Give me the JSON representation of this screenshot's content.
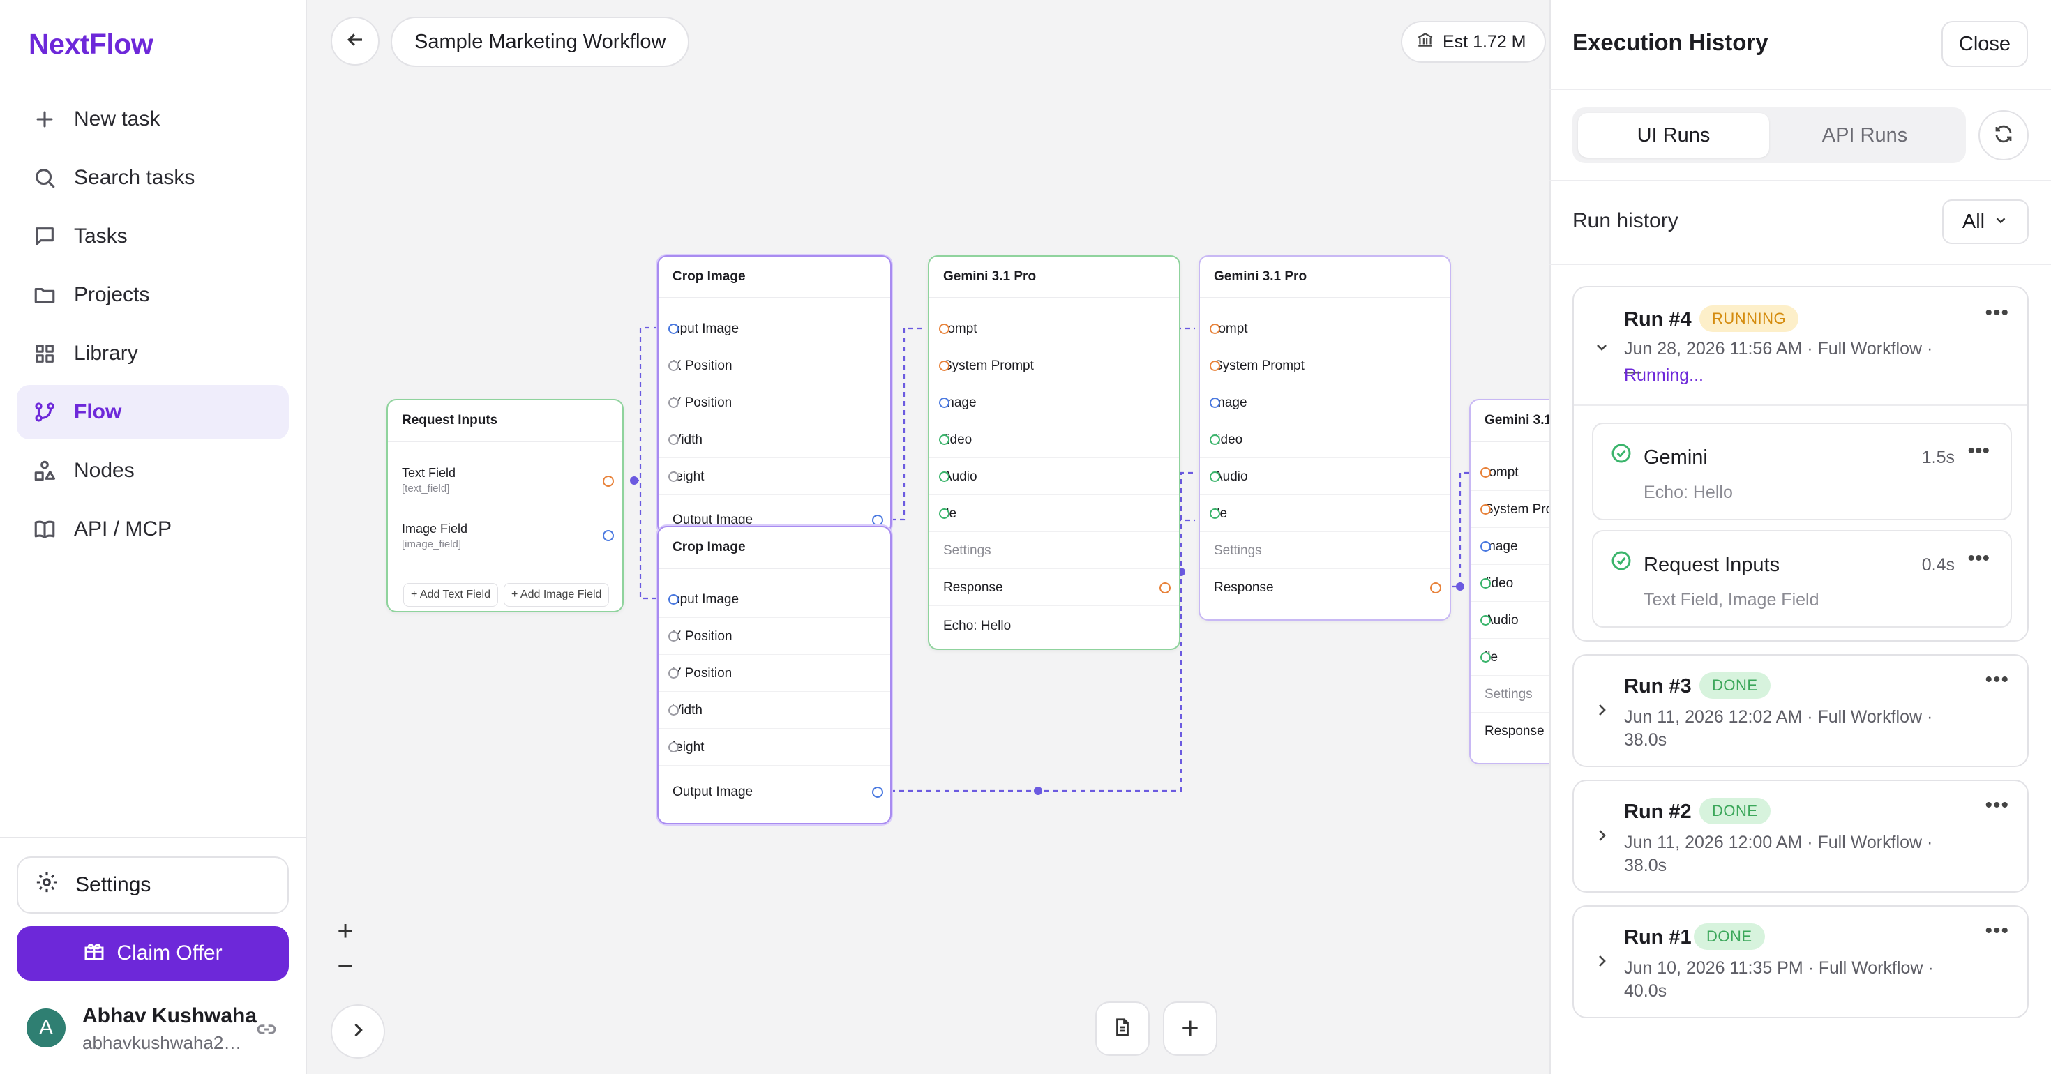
{
  "sidebar": {
    "brand": "NextFlow",
    "items": [
      {
        "label": "New task",
        "icon": "plus-icon"
      },
      {
        "label": "Search tasks",
        "icon": "search-icon"
      },
      {
        "label": "Tasks",
        "icon": "chat-icon"
      },
      {
        "label": "Projects",
        "icon": "folder-icon"
      },
      {
        "label": "Library",
        "icon": "grid-icon"
      },
      {
        "label": "Flow",
        "icon": "flow-icon",
        "active": true
      },
      {
        "label": "Nodes",
        "icon": "shapes-icon"
      },
      {
        "label": "API / MCP",
        "icon": "book-icon"
      }
    ],
    "settings_label": "Settings",
    "claim_label": "Claim Offer",
    "user": {
      "initial": "A",
      "name": "Abhav Kushwaha",
      "email": "abhavkushwaha20..."
    }
  },
  "canvas": {
    "workflow_title": "Sample Marketing Workflow",
    "estimate": "Est 1.72 M",
    "zoom_in": "+",
    "zoom_out": "−",
    "nodes": {
      "request_inputs": {
        "title": "Request Inputs",
        "fields": [
          {
            "label": "Text Field",
            "key": "[text_field]"
          },
          {
            "label": "Image Field",
            "key": "[image_field]"
          }
        ],
        "add_text": "+ Add Text Field",
        "add_image": "+ Add Image Field"
      },
      "crop_1": {
        "title": "Crop Image",
        "rows": [
          "nput Image",
          "X Position",
          "Y Position",
          "Vidth",
          "leight"
        ],
        "output": "Output Image"
      },
      "crop_2": {
        "title": "Crop Image",
        "rows": [
          "nput Image",
          "X Position",
          "Y Position",
          "Vidth",
          "leight"
        ],
        "output": "Output Image"
      },
      "gemini_1": {
        "title": "Gemini 3.1 Pro",
        "rows": [
          "rompt",
          "System Prompt",
          "mage",
          "/ideo",
          "Audio",
          "ile"
        ],
        "settings": "Settings",
        "response": "Response",
        "response_value": "Echo: Hello"
      },
      "gemini_2": {
        "title": "Gemini 3.1 Pro",
        "rows": [
          "rompt",
          "System Prompt",
          "mage",
          "/ideo",
          "Audio",
          "ile"
        ],
        "settings": "Settings",
        "response": "Response"
      },
      "gemini_3": {
        "title": "Gemini 3.1",
        "rows": [
          "rompt",
          "System Pro",
          "mage",
          "/ideo",
          "Audio",
          "ile"
        ],
        "settings": "Settings",
        "response": "Response"
      }
    }
  },
  "panel": {
    "title": "Execution History",
    "close_label": "Close",
    "tabs": [
      "UI Runs",
      "API Runs"
    ],
    "run_history_label": "Run history",
    "filter_value": "All",
    "runs": [
      {
        "title": "Run #4",
        "status": "RUNNING",
        "meta": "Jun 28, 2026 11:56 AM · Full Workflow · —",
        "running_text": "Running...",
        "steps": [
          {
            "name": "Gemini",
            "time": "1.5s",
            "output": "Echo: Hello"
          },
          {
            "name": "Request Inputs",
            "time": "0.4s",
            "output": "Text Field, Image Field"
          }
        ]
      },
      {
        "title": "Run #3",
        "status": "DONE",
        "meta": "Jun 11, 2026 12:02 AM · Full Workflow · 38.0s"
      },
      {
        "title": "Run #2",
        "status": "DONE",
        "meta": "Jun 11, 2026 12:00 AM · Full Workflow · 38.0s"
      },
      {
        "title": "Run #1",
        "status": "DONE",
        "meta": "Jun 10, 2026 11:35 PM · Full Workflow · 40.0s"
      }
    ],
    "colors": {
      "accent": "#6d28d9",
      "running_bg": "#fdefc9",
      "running_fg": "#d48b0e",
      "done_bg": "#d7f3dd",
      "done_fg": "#3ba75a"
    }
  }
}
